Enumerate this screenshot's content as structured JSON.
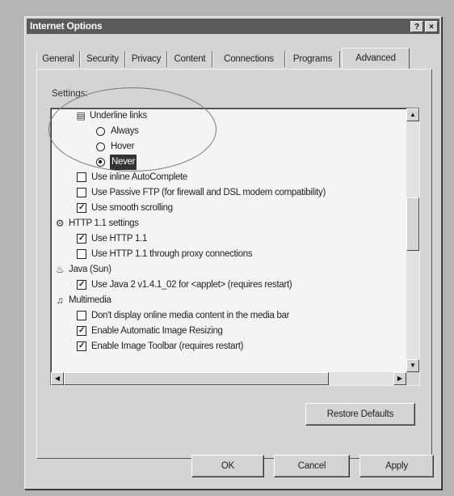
{
  "window": {
    "title": "Internet Options",
    "help_button": "?",
    "close_button": "×"
  },
  "tabs": [
    "General",
    "Security",
    "Privacy",
    "Content",
    "Connections",
    "Programs",
    "Advanced"
  ],
  "active_tab": "Advanced",
  "settings_label": "Settings:",
  "tree": {
    "underline_group": "Underline links",
    "radio_always": "Always",
    "radio_hover": "Hover",
    "radio_never": "Never",
    "inline_autocomplete": "Use inline AutoComplete",
    "passive_ftp": "Use Passive FTP (for firewall and DSL modem compatibility)",
    "smooth_scrolling": "Use smooth scrolling",
    "http_group": "HTTP 1.1 settings",
    "use_http11": "Use HTTP 1.1",
    "http11_proxy": "Use HTTP 1.1 through proxy connections",
    "java_group": "Java (Sun)",
    "use_java2": "Use Java 2 v1.4.1_02 for <applet> (requires restart)",
    "multimedia_group": "Multimedia",
    "no_online_media": "Don't display online media content in the media bar",
    "auto_image_resize": "Enable Automatic Image Resizing",
    "image_toolbar": "Enable Image Toolbar (requires restart)"
  },
  "checked": {
    "inline_autocomplete": false,
    "passive_ftp": false,
    "smooth_scrolling": true,
    "use_http11": true,
    "http11_proxy": false,
    "use_java2": true,
    "no_online_media": false,
    "auto_image_resize": true,
    "image_toolbar": true
  },
  "selected_underline": "Never",
  "check_glyph": "✓",
  "buttons": {
    "restore_defaults": "Restore Defaults",
    "ok": "OK",
    "cancel": "Cancel",
    "apply": "Apply"
  },
  "icons": {
    "underline_group": "link-settings-icon",
    "http_group": "http-settings-icon",
    "java_group": "java-cup-icon",
    "multimedia_group": "multimedia-icon"
  },
  "colors": {
    "titlebar": "#5a5a5a",
    "dialog": "#d4d4d4",
    "background": "#b4b4b4",
    "list": "#f4f4f4",
    "selection": "#333333"
  }
}
